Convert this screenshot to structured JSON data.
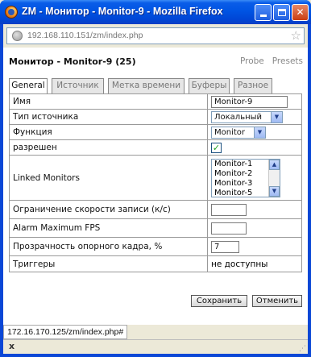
{
  "window": {
    "title": "ZM - Монитор - Monitor-9 - Mozilla Firefox"
  },
  "urlbar": {
    "url": "192.168.110.151/zm/index.php"
  },
  "page": {
    "title": "Монитор - Monitor-9 (25)",
    "links": [
      "Probe",
      "Presets"
    ]
  },
  "tabs": [
    "General",
    "Источник",
    "Метка времени",
    "Буферы",
    "Разное"
  ],
  "active_tab": "General",
  "form": {
    "name_label": "Имя",
    "name_value": "Monitor-9",
    "source_type_label": "Тип источника",
    "source_type_value": "Локальный",
    "function_label": "Функция",
    "function_value": "Monitor",
    "enabled_label": "разрешен",
    "enabled_checked": true,
    "linked_label": "Linked Monitors",
    "linked_options": [
      "Monitor-1",
      "Monitor-2",
      "Monitor-3",
      "Monitor-5"
    ],
    "max_rate_label": "Ограничение скорости записи (к/с)",
    "max_rate_value": "",
    "alarm_fps_label": "Alarm Maximum FPS",
    "alarm_fps_value": "",
    "ref_blend_label": "Прозрачность опорного кадра, %",
    "ref_blend_value": "7",
    "triggers_label": "Триггеры",
    "triggers_value": "не доступны"
  },
  "buttons": {
    "save": "Сохранить",
    "cancel": "Отменить"
  },
  "statusbar": {
    "text": "172.16.170.125/zm/index.php#"
  }
}
